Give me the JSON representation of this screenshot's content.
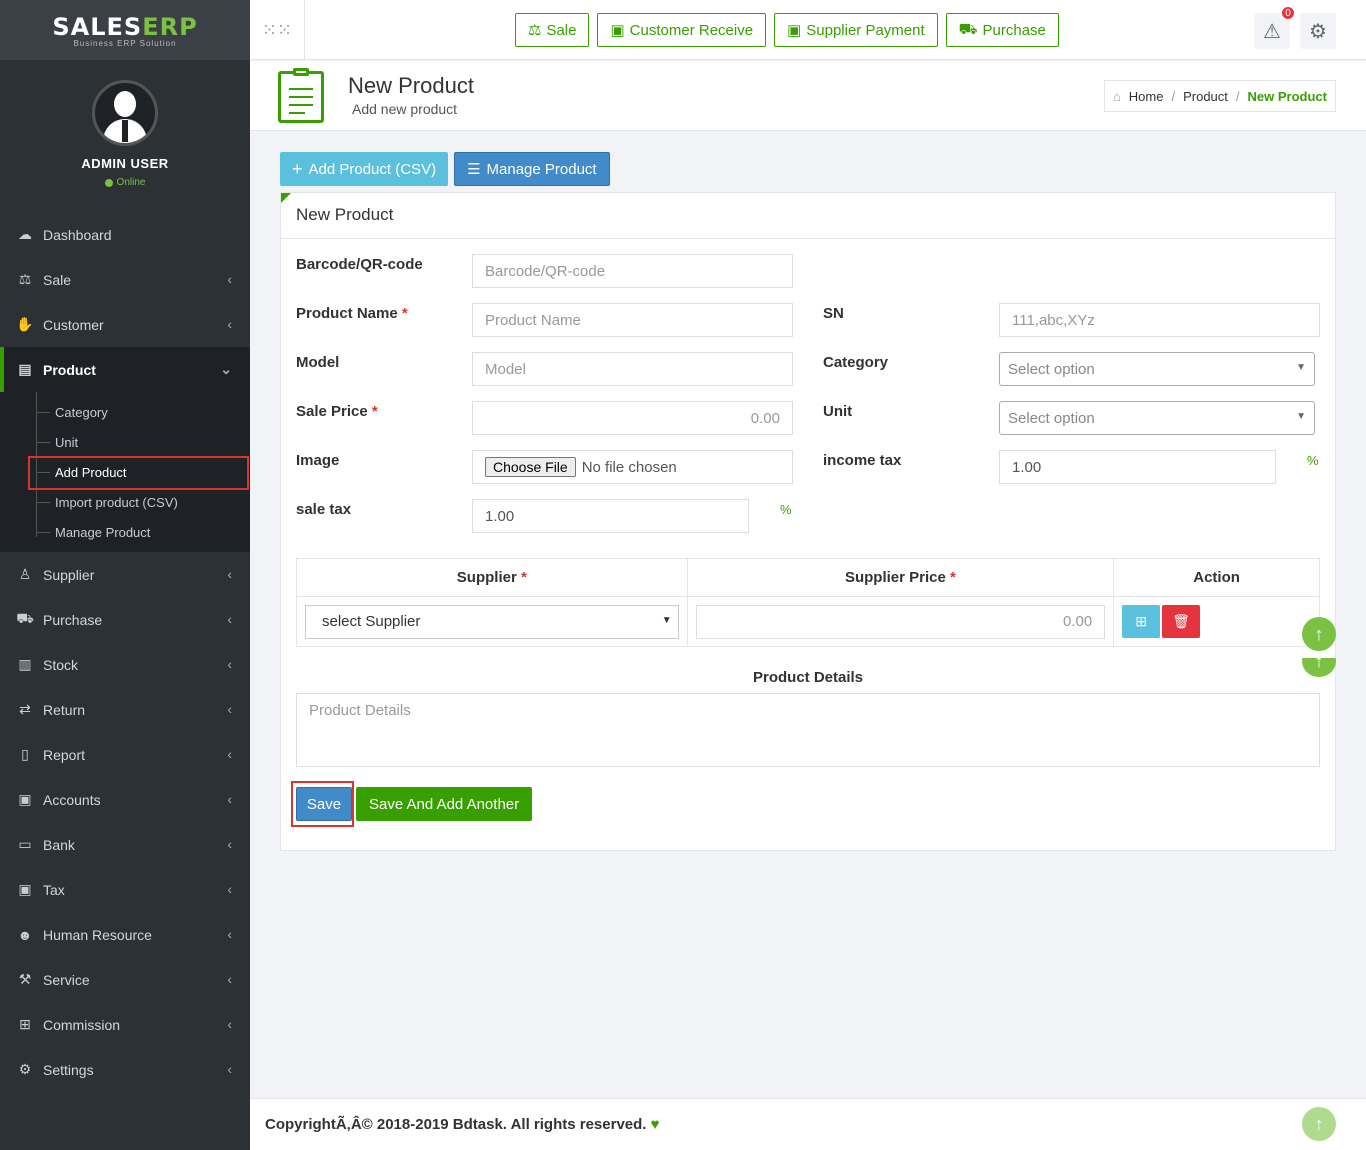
{
  "brand": {
    "logo_left": "SALES",
    "logo_right": "ERP",
    "tagline": "Business ERP Solution"
  },
  "user": {
    "name": "ADMIN USER",
    "status": "Online"
  },
  "sidebar": {
    "items": [
      {
        "label": "Dashboard",
        "icon": "dashboard-icon"
      },
      {
        "label": "Sale",
        "icon": "balance-scale-icon"
      },
      {
        "label": "Customer",
        "icon": "handshake-icon"
      },
      {
        "label": "Product",
        "icon": "shopping-bag-icon"
      },
      {
        "label": "Supplier",
        "icon": "user-icon"
      },
      {
        "label": "Purchase",
        "icon": "cart-icon"
      },
      {
        "label": "Stock",
        "icon": "bar-chart-icon"
      },
      {
        "label": "Return",
        "icon": "retweet-icon"
      },
      {
        "label": "Report",
        "icon": "book-icon"
      },
      {
        "label": "Accounts",
        "icon": "money-icon"
      },
      {
        "label": "Bank",
        "icon": "briefcase-icon"
      },
      {
        "label": "Tax",
        "icon": "money-icon"
      },
      {
        "label": "Human Resource",
        "icon": "users-icon"
      },
      {
        "label": "Service",
        "icon": "wrench-icon"
      },
      {
        "label": "Commission",
        "icon": "grid-icon"
      },
      {
        "label": "Settings",
        "icon": "gear-icon"
      }
    ],
    "product_submenu": [
      "Category",
      "Unit",
      "Add Product",
      "Import product (CSV)",
      "Manage Product"
    ]
  },
  "topbar": {
    "buttons": [
      "Sale",
      "Customer Receive",
      "Supplier Payment",
      "Purchase"
    ],
    "notification_count": "0"
  },
  "header": {
    "title": "New Product",
    "subtitle": "Add new product",
    "breadcrumb": [
      "Home",
      "Product",
      "New Product"
    ]
  },
  "actions": {
    "add_csv": "Add Product (CSV)",
    "manage": "Manage Product"
  },
  "form": {
    "panel_title": "New Product",
    "barcode_label": "Barcode/QR-code",
    "barcode_placeholder": "Barcode/QR-code",
    "name_label": "Product Name",
    "name_placeholder": "Product Name",
    "sn_label": "SN",
    "sn_placeholder": "111,abc,XYz",
    "model_label": "Model",
    "model_placeholder": "Model",
    "category_label": "Category",
    "category_value": "Select option",
    "price_label": "Sale Price",
    "price_placeholder": "0.00",
    "unit_label": "Unit",
    "unit_value": "Select option",
    "image_label": "Image",
    "file_button": "Choose File",
    "file_status": "No file chosen",
    "income_tax_label": "income tax",
    "income_tax_value": "1.00",
    "sale_tax_label": "sale tax",
    "sale_tax_value": "1.00",
    "percent": "%",
    "required_mark": "*"
  },
  "supplier_table": {
    "headers": [
      "Supplier",
      "Supplier Price",
      "Action"
    ],
    "supplier_select": "select Supplier",
    "price_placeholder": "0.00"
  },
  "details": {
    "label": "Product Details",
    "placeholder": "Product Details"
  },
  "buttons": {
    "save": "Save",
    "save_add": "Save And Add Another"
  },
  "footer": {
    "text": "CopyrightÃ‚Â© 2018-2019 Bdtask. All rights reserved."
  },
  "colors": {
    "accent": "#37a000",
    "sidebar": "#2c3136",
    "primary": "#428bca",
    "info": "#5bc0de",
    "danger": "#e5343d"
  }
}
